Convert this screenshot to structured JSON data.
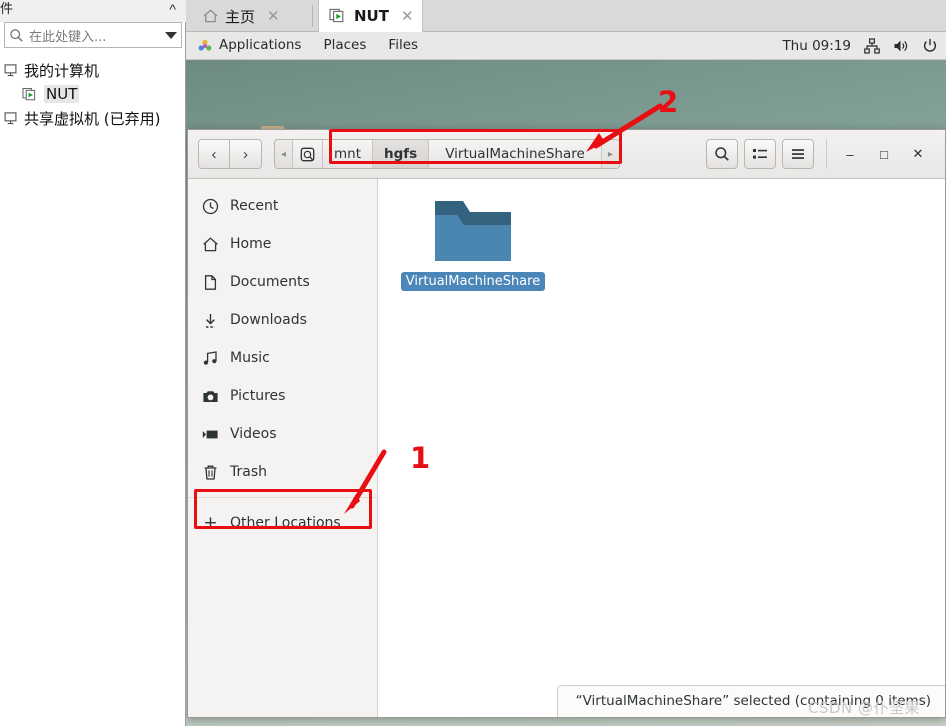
{
  "vmware": {
    "search": {
      "placeholder": "在此处键入...",
      "icon": "search-icon",
      "dropdown_icon": "caret-down-icon"
    },
    "close_label": "✕",
    "tree": [
      {
        "label": "我的计算机",
        "icon": "monitor-icon",
        "selected": false,
        "indent": false
      },
      {
        "label": "NUT",
        "icon": "virtual-machine-icon",
        "selected": true,
        "indent": true
      },
      {
        "label": "共享虚拟机 (已弃用)",
        "icon": "monitor-icon",
        "selected": false,
        "indent": false
      }
    ],
    "tabs": [
      {
        "label": "主页",
        "icon": "home-icon",
        "active": false,
        "close": "✕"
      },
      {
        "label": "NUT",
        "icon": "virtual-machine-icon",
        "active": true,
        "close": "✕"
      }
    ]
  },
  "gnome_panel": {
    "menus": [
      "Applications",
      "Places",
      "Files"
    ],
    "apps_icon": "applications-icon",
    "clock": "Thu 09:19",
    "tray": [
      "network-icon",
      "volume-icon",
      "power-icon"
    ]
  },
  "nautilus": {
    "nav": {
      "back": "‹",
      "forward": "›",
      "back_icon": "chevron-left-icon",
      "forward_icon": "chevron-right-icon"
    },
    "pathbar": {
      "scroll_left": "◂",
      "scroll_right": "▸",
      "device_icon": "hard-disk-icon",
      "crumbs": [
        {
          "label": "mnt",
          "current": false
        },
        {
          "label": "hgfs",
          "current": true
        },
        {
          "label": "VirtualMachineShare",
          "current": false
        }
      ]
    },
    "toolbar": {
      "search_icon": "search-icon",
      "view_icon": "list-view-icon",
      "menu_icon": "hamburger-menu-icon"
    },
    "window_controls": {
      "minimize": "–",
      "maximize": "□",
      "close": "✕"
    },
    "places": [
      {
        "label": "Recent",
        "icon": "clock-icon"
      },
      {
        "label": "Home",
        "icon": "home-icon"
      },
      {
        "label": "Documents",
        "icon": "document-icon"
      },
      {
        "label": "Downloads",
        "icon": "download-icon"
      },
      {
        "label": "Music",
        "icon": "music-note-icon"
      },
      {
        "label": "Pictures",
        "icon": "camera-icon"
      },
      {
        "label": "Videos",
        "icon": "video-icon"
      },
      {
        "label": "Trash",
        "icon": "trash-icon"
      }
    ],
    "other_locations": {
      "label": "Other Locations",
      "icon": "plus-icon"
    },
    "files": [
      {
        "name": "VirtualMachineShare",
        "icon": "folder-icon",
        "selected": true
      }
    ],
    "status": "“VirtualMachineShare” selected  (containing 0 items)"
  },
  "annotations": {
    "marker_one": "1",
    "marker_two": "2",
    "color": "#e80e12"
  },
  "watermark": "CSDN @仆坚果"
}
